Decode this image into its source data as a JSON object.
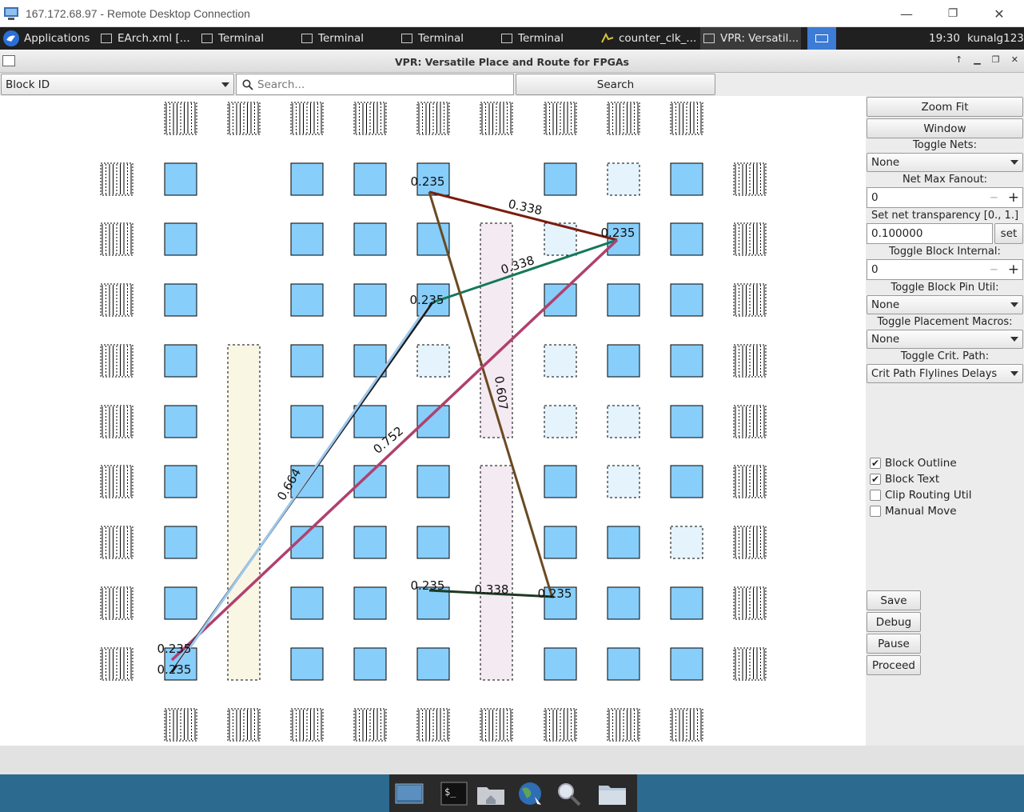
{
  "rdp": {
    "title": "167.172.68.97 - Remote Desktop Connection",
    "minimize": "—",
    "maximize": "❐",
    "close": "✕"
  },
  "taskbar": {
    "applications_label": "Applications",
    "items": [
      {
        "label": "EArch.xml [..."
      },
      {
        "label": "Terminal"
      },
      {
        "label": "Terminal"
      },
      {
        "label": "Terminal"
      },
      {
        "label": "Terminal"
      },
      {
        "label": "counter_clk_..."
      },
      {
        "label": "VPR: Versatil..."
      }
    ],
    "clock": "19:30",
    "user": "kunalg123"
  },
  "vpr": {
    "title": "VPR: Versatile Place and Route for FPGAs",
    "search_type": "Block ID",
    "search_placeholder": "Search...",
    "search_button": "Search"
  },
  "side": {
    "zoom_fit": "Zoom Fit",
    "window": "Window",
    "toggle_nets_label": "Toggle Nets:",
    "toggle_nets_value": "None",
    "net_max_fanout_label": "Net Max Fanout:",
    "net_max_fanout_value": "0",
    "transparency_label": "Set net transparency [0., 1.]",
    "transparency_value": "0.100000",
    "set_button": "set",
    "block_internal_label": "Toggle Block Internal:",
    "block_internal_value": "0",
    "pin_util_label": "Toggle Block Pin Util:",
    "pin_util_value": "None",
    "macros_label": "Toggle Placement Macros:",
    "macros_value": "None",
    "crit_path_label": "Toggle Crit. Path:",
    "crit_path_value": "Crit Path Flylines Delays",
    "minus": "−",
    "plus": "+",
    "checkboxes": [
      {
        "label": "Block Outline",
        "checked": true
      },
      {
        "label": "Block Text",
        "checked": true
      },
      {
        "label": "Clip Routing Util",
        "checked": false
      },
      {
        "label": "Manual Move",
        "checked": false
      }
    ],
    "save": "Save",
    "debug": "Debug",
    "pause": "Pause",
    "proceed": "Proceed"
  },
  "flylines": {
    "labels": [
      "0.235",
      "0.338",
      "0.235",
      "0.338",
      "0.235",
      "0.607",
      "0.752",
      "0.664",
      "0.235",
      "0.338",
      "0.235",
      "0.235",
      "0.235"
    ],
    "colors": {
      "brown_dark": "#7a1c10",
      "green": "#14785a",
      "pink": "#b0406e",
      "black": "#1a1a1a",
      "lightblue": "#9cc8ee",
      "brown": "#6a4a22",
      "darkgreen": "#1f3a22"
    }
  },
  "colors": {
    "clb_fill": "#87cefa",
    "empty_clb": "#e4f3fc",
    "yellow_col": "#faf6e4",
    "pink_col": "#f4eaf2"
  }
}
